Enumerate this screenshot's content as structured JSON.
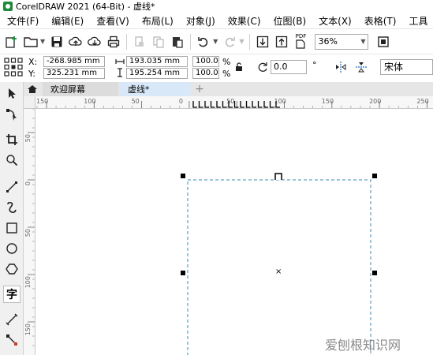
{
  "window": {
    "title": "CorelDRAW 2021 (64-Bit) - 虚线*"
  },
  "menu": [
    "文件(F)",
    "编辑(E)",
    "查看(V)",
    "布局(L)",
    "对象(J)",
    "效果(C)",
    "位图(B)",
    "文本(X)",
    "表格(T)",
    "工具"
  ],
  "toolbar": {
    "zoom": "36%",
    "pdf_label": "PDF"
  },
  "property_bar": {
    "x_label": "X:",
    "y_label": "Y:",
    "x_value": "-268.985 mm",
    "y_value": "325.231 mm",
    "width_value": "193.035 mm",
    "height_value": "195.254 mm",
    "scale_x": "100.0",
    "scale_y": "100.0",
    "percent": "%",
    "rotation": "0.0",
    "degree": "°",
    "font": "宋体"
  },
  "tabs": {
    "welcome": "欢迎屏幕",
    "document": "虚线*",
    "add": "+"
  },
  "ruler": {
    "h_ticks": [
      "150",
      "100",
      "50",
      "0",
      "50",
      "100",
      "150",
      "200",
      "250"
    ],
    "v_ticks": [
      "50",
      "0",
      "50",
      "100",
      "150"
    ]
  },
  "toolbox": {
    "text_tool_glyph": "字"
  },
  "canvas": {
    "center_mark": "×"
  },
  "watermark": "爱刨根知识网"
}
